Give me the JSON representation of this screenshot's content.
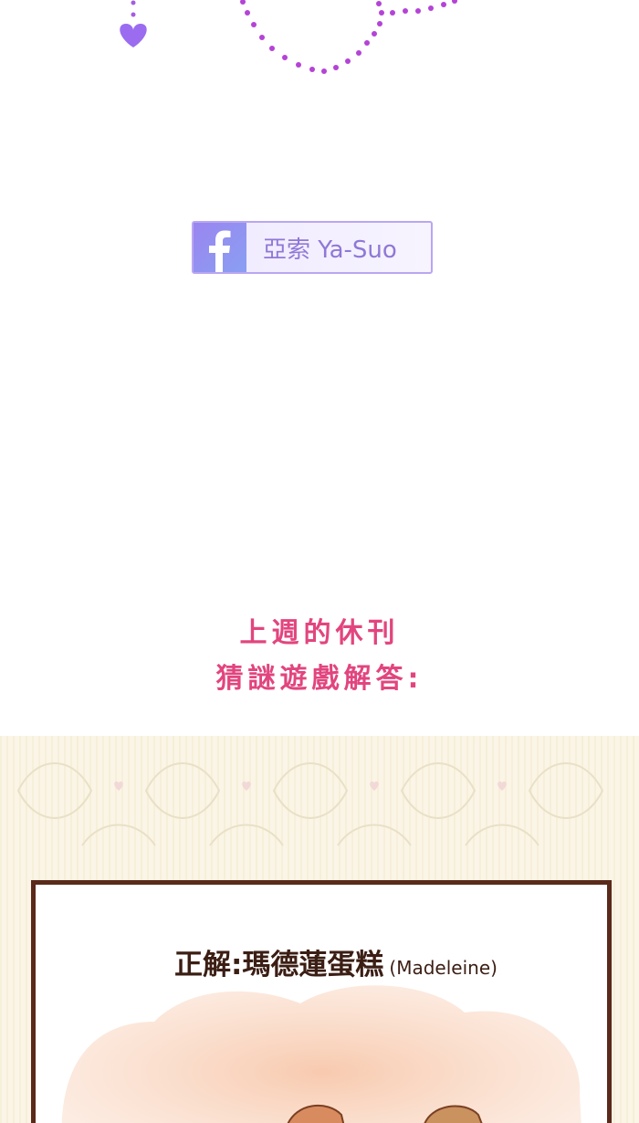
{
  "facebook_badge": {
    "text": "亞索 Ya-Suo",
    "icon": "facebook-icon",
    "accent_color": "#8f78d6"
  },
  "notice": {
    "line1": "上週的休刊",
    "line2": "猜謎遊戲解答:",
    "color": "#e2457e"
  },
  "answer_card": {
    "answer_label": "正解:瑪德蓮蛋糕",
    "answer_latin": "(Madeleine)",
    "border_color": "#5a2a1a"
  }
}
